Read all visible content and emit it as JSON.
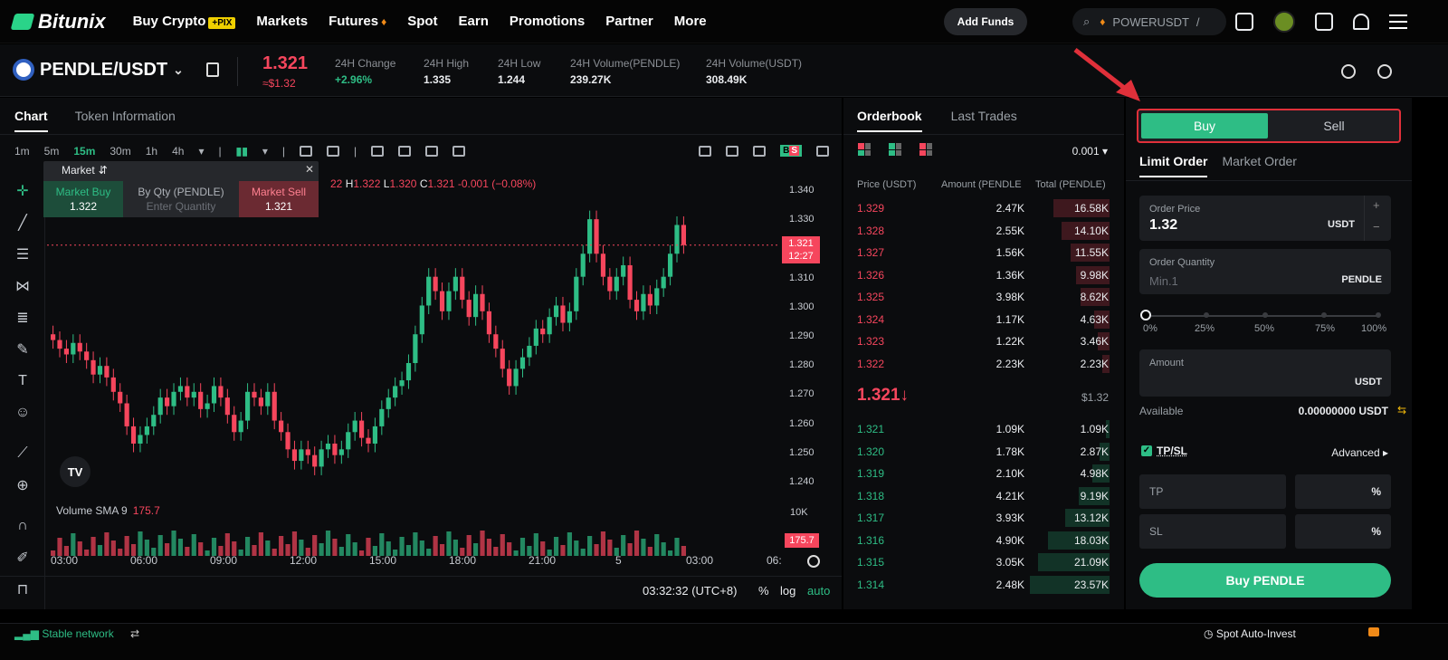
{
  "nav": {
    "brand": "Bitunix",
    "menu": [
      "Buy Crypto",
      "Markets",
      "Futures",
      "Spot",
      "Earn",
      "Promotions",
      "Partner",
      "More"
    ],
    "pix_badge": "+PIX",
    "add_funds": "Add Funds",
    "search_text": "POWERUSDT",
    "search_sep": "/"
  },
  "ticker": {
    "pair": "PENDLE/USDT",
    "price": "1.321",
    "price_usd": "≈$1.32",
    "stats": [
      {
        "label": "24H Change",
        "value": "+2.96%"
      },
      {
        "label": "24H High",
        "value": "1.335"
      },
      {
        "label": "24H Low",
        "value": "1.244"
      },
      {
        "label": "24H Volume(PENDLE)",
        "value": "239.27K"
      },
      {
        "label": "24H Volume(USDT)",
        "value": "308.49K"
      }
    ]
  },
  "chart": {
    "tabs": [
      "Chart",
      "Token Information"
    ],
    "timeframes": [
      "1m",
      "5m",
      "15m",
      "30m",
      "1h",
      "4h"
    ],
    "active_timeframe": "15m",
    "ohlc": {
      "h_label": "H",
      "h": "1.322",
      "l_label": "L",
      "l": "1.320",
      "c_label": "C",
      "c": "1.321",
      "change": "-0.001 (−0.08%)",
      "prefix": "22"
    },
    "market_box": {
      "title": "Market",
      "buy_label": "Market Buy",
      "buy_value": "1.322",
      "qty_label": "By Qty (PENDLE)",
      "qty_placeholder": "Enter Quantity",
      "sell_label": "Market Sell",
      "sell_value": "1.321"
    },
    "y_ticks": [
      "1.340",
      "1.330",
      "1.320",
      "1.310",
      "1.300",
      "1.290",
      "1.280",
      "1.270",
      "1.260",
      "1.250",
      "1.240"
    ],
    "price_tag": "1.321",
    "price_tag_time": "12:27",
    "volume_label": "Volume SMA 9",
    "volume_value": "175.7",
    "volume_axis": "10K",
    "x_ticks": [
      "03:00",
      "06:00",
      "09:00",
      "12:00",
      "15:00",
      "18:00",
      "21:00",
      "5",
      "03:00",
      "06:"
    ],
    "clock": "03:32:32 (UTC+8)",
    "bottom_opts": [
      "%",
      "log",
      "auto"
    ],
    "tv_logo": "TV"
  },
  "orderbook": {
    "tabs": [
      "Orderbook",
      "Last Trades"
    ],
    "tick_size": "0.001",
    "headers": [
      "Price (USDT)",
      "Amount (PENDLE",
      "Total (PENDLE)"
    ],
    "asks": [
      [
        "1.329",
        "2.47K",
        "16.58K"
      ],
      [
        "1.328",
        "2.55K",
        "14.10K"
      ],
      [
        "1.327",
        "1.56K",
        "11.55K"
      ],
      [
        "1.326",
        "1.36K",
        "9.98K"
      ],
      [
        "1.325",
        "3.98K",
        "8.62K"
      ],
      [
        "1.324",
        "1.17K",
        "4.63K"
      ],
      [
        "1.323",
        "1.22K",
        "3.46K"
      ],
      [
        "1.322",
        "2.23K",
        "2.23K"
      ]
    ],
    "mid_price": "1.321↓",
    "mid_usd": "$1.32",
    "bids": [
      [
        "1.321",
        "1.09K",
        "1.09K"
      ],
      [
        "1.320",
        "1.78K",
        "2.87K"
      ],
      [
        "1.319",
        "2.10K",
        "4.98K"
      ],
      [
        "1.318",
        "4.21K",
        "9.19K"
      ],
      [
        "1.317",
        "3.93K",
        "13.12K"
      ],
      [
        "1.316",
        "4.90K",
        "18.03K"
      ],
      [
        "1.315",
        "3.05K",
        "21.09K"
      ],
      [
        "1.314",
        "2.48K",
        "23.57K"
      ]
    ]
  },
  "form": {
    "buy": "Buy",
    "sell": "Sell",
    "order_tabs": [
      "Limit Order",
      "Market Order"
    ],
    "order_price_label": "Order Price",
    "order_price": "1.32",
    "order_price_unit": "USDT",
    "qty_label": "Order Quantity",
    "qty_placeholder": "Min.1",
    "qty_unit": "PENDLE",
    "slider_marks": [
      "0%",
      "25%",
      "50%",
      "75%",
      "100%"
    ],
    "slider_value": 0,
    "amount_label": "Amount",
    "amount_unit": "USDT",
    "available_label": "Available",
    "available_value": "0.00000000 USDT",
    "tpsl_label": "TP/SL",
    "advanced": "Advanced",
    "tp": "TP",
    "sl": "SL",
    "pct": "%",
    "buy_button": "Buy PENDLE"
  },
  "status": {
    "network": "Stable network",
    "auto_invest": "Spot Auto-Invest"
  },
  "colors": {
    "up": "#2ebd85",
    "down": "#f6465d",
    "highlight": "#e0303a"
  }
}
